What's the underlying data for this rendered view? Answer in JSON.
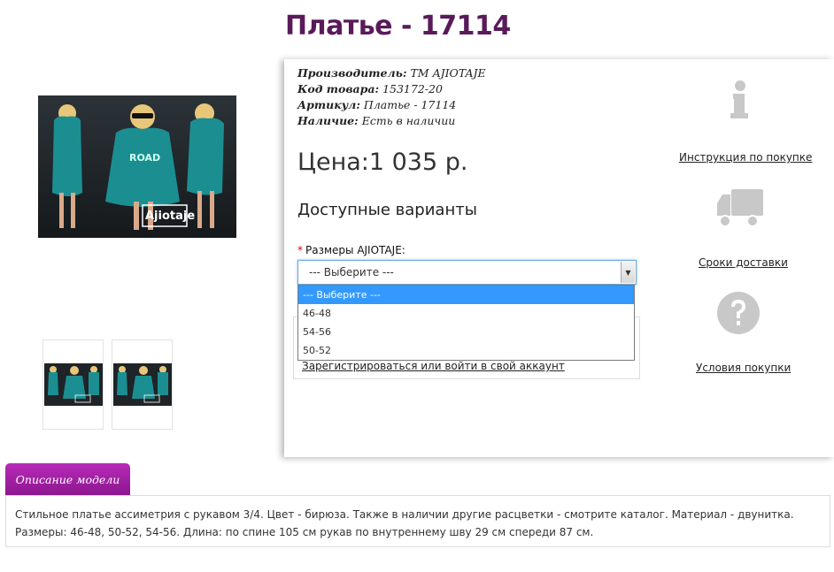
{
  "product": {
    "title": "Платье - 17114",
    "meta": {
      "manufacturer_label": "Производитель:",
      "manufacturer_value": "ТМ AJIOTAJE",
      "code_label": "Код товара:",
      "code_value": "153172-20",
      "sku_label": "Артикул:",
      "sku_value": "Платье - 17114",
      "stock_label": "Наличие:",
      "stock_value": "Есть в наличии"
    },
    "price": "Цена:1 035 р.",
    "variants_heading": "Доступные варианты",
    "size_required": "*",
    "size_label": "Размеры AJIOTAJE:",
    "size_select_value": "--- Выберите ---",
    "size_options": [
      "--- Выберите ---",
      "46-48",
      "54-56",
      "50-52"
    ],
    "login_link": "Зарегистрироваться или войти в свой аккаунт",
    "photo_logo": "Ajiotaje"
  },
  "side": {
    "instruction_link": "Инструкция по покупке",
    "delivery_link": "Сроки доставки",
    "terms_link": "Условия покупки"
  },
  "description": {
    "tab_label": "Описание модели",
    "text": "Стильное платье ассиметрия с рукавом 3/4. Цвет - бирюза. Также в наличии другие расцветки - смотрите каталог. Материал - двунитка. Размеры: 46-48, 50-52, 54-56. Длина: по спине 105 см рукав по внутреннему шву 29 см спереди 87 см."
  },
  "colors": {
    "title": "#5a1a5a",
    "tab": "#a020a2",
    "dress": "#1b8e92",
    "select_highlight": "#3399ff"
  }
}
